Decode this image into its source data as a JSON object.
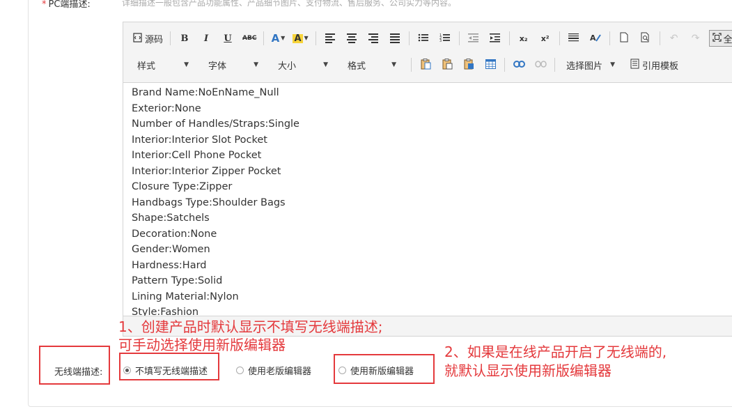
{
  "pc_desc": {
    "required_mark": "*",
    "label": "PC端描述:",
    "hint": "详细描述一般包含产品功能属性、产品细节图片、支付物流、售后服务、公司实力等内容。"
  },
  "toolbar": {
    "row1": {
      "source_label": "源码",
      "bold": "B",
      "italic": "I",
      "underline": "U",
      "strike": "ABC",
      "font_color": "A",
      "bg_color": "A",
      "subscript": "x₂",
      "superscript": "x²",
      "fullscreen_label": "全"
    },
    "row2": {
      "style_select": "样式",
      "font_select": "字体",
      "size_select": "大小",
      "format_select": "格式",
      "image_select": "选择图片",
      "template_label": "引用模板"
    }
  },
  "content_lines": [
    "Brand Name:NoEnName_Null",
    "Exterior:None",
    "Number of Handles/Straps:Single",
    "Interior:Interior Slot Pocket",
    "Interior:Cell Phone Pocket",
    "Interior:Interior Zipper Pocket",
    "Closure Type:Zipper",
    "Handbags Type:Shoulder Bags",
    "Shape:Satchels",
    "Decoration:None",
    "Gender:Women",
    "Hardness:Hard",
    "Pattern Type:Solid",
    "Lining Material:Nylon",
    "Style:Fashion"
  ],
  "wireless": {
    "label": "无线端描述:",
    "options": [
      {
        "label": "不填写无线端描述",
        "selected": true
      },
      {
        "label": "使用老版编辑器",
        "selected": false
      },
      {
        "label": "使用新版编辑器",
        "selected": false
      }
    ]
  },
  "annotations": {
    "note1_line1": "1、创建产品时默认显示不填写无线端描述;",
    "note1_line2": "可手动选择使用新版编辑器",
    "note2_line1": "2、如果是在线产品开启了无线端的,",
    "note2_line2": "就默认显示使用新版编辑器",
    "color": "#e4393c"
  },
  "colors": {
    "accent_blue": "#3276c3",
    "highlight_yellow": "#f7d43a",
    "annotation_red": "#e4393c"
  }
}
